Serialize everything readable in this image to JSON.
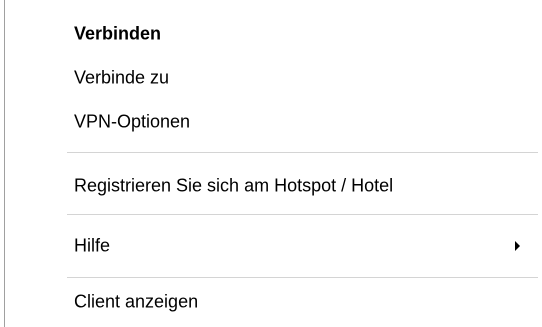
{
  "context_menu": {
    "items": [
      {
        "label": "Verbinden",
        "default": true
      },
      {
        "label": "Verbinde zu"
      },
      {
        "label": "VPN-Optionen"
      },
      {
        "label": "Registrieren Sie sich am Hotspot / Hotel"
      },
      {
        "label": "Hilfe",
        "has_submenu": true,
        "submenu_icon": "chevron-right-icon"
      },
      {
        "label": "Client anzeigen"
      }
    ]
  }
}
